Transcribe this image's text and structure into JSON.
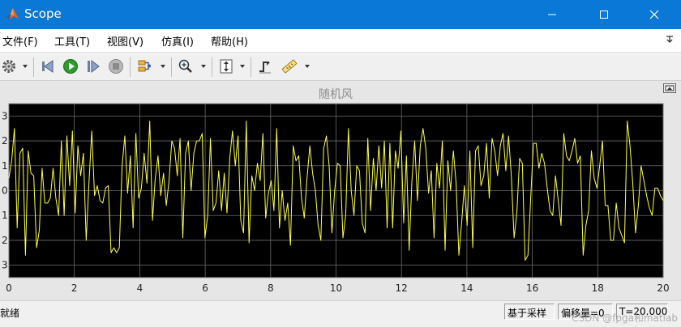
{
  "window": {
    "title": "Scope",
    "icon": "matlab-logo-icon",
    "controls": [
      "minimize-icon",
      "maximize-icon",
      "close-icon"
    ]
  },
  "menu": {
    "file": "文件(F)",
    "tools": "工具(T)",
    "view": "视图(V)",
    "simulation": "仿真(I)",
    "help": "帮助(H)"
  },
  "toolbar": {
    "items": [
      "gear-icon",
      "step-back-icon",
      "run-icon",
      "step-forward-icon",
      "stop-icon",
      "signal-select-icon",
      "zoom-in-icon",
      "scale-axes-icon",
      "trigger-icon",
      "measure-icon"
    ]
  },
  "plot": {
    "title": "随机风",
    "background": "#000000",
    "grid_color": "#6a6a6a",
    "line_color": "#ffff4a",
    "text_color": "#d6d6d6"
  },
  "chart_data": {
    "type": "line",
    "title": "随机风",
    "xlabel": "",
    "ylabel": "",
    "xlim": [
      0,
      20
    ],
    "ylim": [
      -3.5,
      3.5
    ],
    "xticks": [
      0,
      2,
      4,
      6,
      8,
      10,
      12,
      14,
      16,
      18,
      20
    ],
    "yticks": [
      3,
      2,
      1,
      0,
      -1,
      -2,
      -3
    ],
    "ytick_labels": [
      "3",
      "2",
      "1",
      "0",
      "1",
      "2",
      "3"
    ],
    "grid": true,
    "series": [
      {
        "values": [
          0.5,
          1.2,
          2.5,
          -1.5,
          1.5,
          1.7,
          -2.6,
          1.6,
          0.7,
          0.6,
          -2.3,
          -1.6,
          0.9,
          -0.5,
          -0.5,
          -0.3,
          0.9,
          -0.3,
          -1.0,
          2.0,
          -1.0,
          2.2,
          0.2,
          2.4,
          -0.9,
          1.8,
          0.6,
          1.5,
          -2.0,
          0.3,
          2.4,
          -0.2,
          0.2,
          -0.4,
          -0.5,
          0.1,
          0.2,
          -2.5,
          -2.3,
          -2.5,
          -2.3,
          1.0,
          2.2,
          -0.1,
          1.4,
          -1.5,
          2.3,
          -0.3,
          0.1,
          1.5,
          0.3,
          2.8,
          -1.2,
          0.5,
          1.4,
          -0.2,
          0.7,
          -0.6,
          0.4,
          2.0,
          1.7,
          0.6,
          2.1,
          -1.9,
          1.5,
          2.0,
          0.0,
          1.5,
          2.0,
          2.0,
          2.3,
          -1.9,
          -1.0,
          2.1,
          -0.8,
          -0.5,
          0.8,
          -0.8,
          0.7,
          -0.9,
          1.3,
          2.4,
          1.0,
          2.2,
          -1.2,
          -1.7,
          2.8,
          -2.1,
          0.6,
          0.0,
          1.1,
          0.4,
          2.3,
          -1.1,
          -0.1,
          0.4,
          -0.8,
          2.5,
          -1.5,
          0.0,
          -1.2,
          -0.5,
          -2.2,
          1.8,
          1.2,
          1.4,
          -0.3,
          -1.1,
          0.5,
          1.8,
          0.7,
          0.0,
          -1.4,
          -2.0,
          1.7,
          2.2,
          1.0,
          -1.7,
          0.0,
          1.1,
          1.0,
          -1.9,
          -1.0,
          2.5,
          0.0,
          -1.0,
          1.0,
          0.8,
          -1.3,
          -1.7,
          2.1,
          -0.8,
          1.3,
          0.0,
          1.8,
          0.1,
          2.0,
          -1.5,
          1.9,
          -1.5,
          1.6,
          0.9,
          2.4,
          -1.3,
          1.4,
          -2.4,
          0.4,
          2.0,
          -0.4,
          1.8,
          2.5,
          1.7,
          -0.1,
          0.8,
          -1.9,
          1.1,
          0.1,
          2.0,
          -2.4,
          1.2,
          0.0,
          1.6,
          0.3,
          -2.6,
          -1.3,
          0.2,
          -1.4,
          1.6,
          -2.3,
          1.6,
          1.8,
          0.2,
          0.6,
          1.9,
          -0.3,
          2.1,
          1.6,
          0.6,
          1.8,
          2.3,
          0.8,
          2.2,
          0.6,
          -1.9,
          -0.9,
          1.3,
          1.1,
          -2.8,
          -2.6,
          -0.3,
          1.9,
          1.9,
          0.9,
          1.5,
          1.1,
          0.1,
          -0.8,
          -1.0,
          0.6,
          -0.4,
          -1.4,
          2.3,
          1.4,
          1.2,
          1.6,
          2.1,
          1.1,
          1.4,
          -2.6,
          -1.4,
          -0.8,
          1.6,
          0.5,
          0.1,
          1.0,
          2.0,
          -0.6,
          -0.6,
          -2.0,
          -2.0,
          -0.5,
          -1.5,
          -1.8,
          -2.1,
          2.8,
          1.8,
          0.3,
          -1.7,
          -0.6,
          1.0,
          0.4,
          -0.2,
          -0.7,
          -1.0,
          0.1,
          0.1,
          -0.2,
          -0.4
        ]
      }
    ]
  },
  "statusbar": {
    "ready": "就绪",
    "sample_mode": "基于采样",
    "offset": "偏移量=0",
    "time": "T=20.000",
    "watermark": "CSDN @fpga和matlab"
  }
}
